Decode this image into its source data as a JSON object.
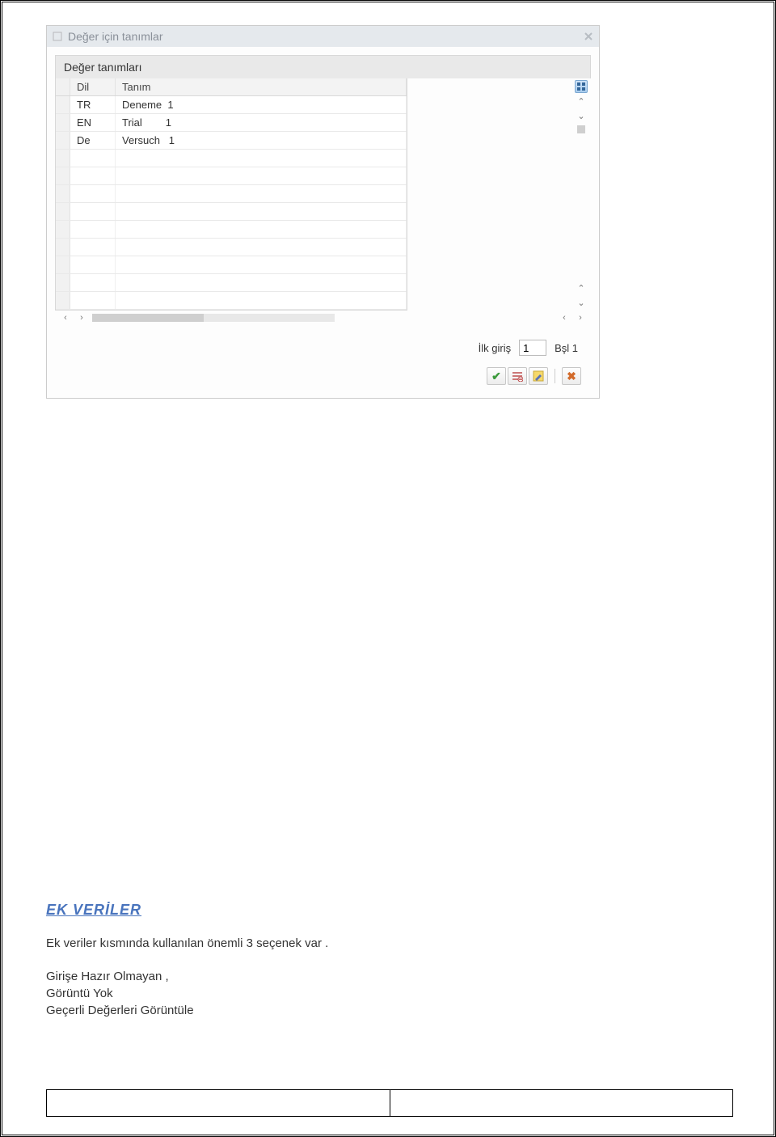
{
  "dialog": {
    "title": "Değer  için tanımlar",
    "panel_label": "Değer tanımları",
    "columns": {
      "dil": "Dil",
      "tanim": "Tanım"
    },
    "rows": [
      {
        "dil": "TR",
        "tanim": "Deneme  1"
      },
      {
        "dil": "EN",
        "tanim": "Trial        1"
      },
      {
        "dil": "De",
        "tanim": "Versuch   1"
      }
    ],
    "entry": {
      "label_ilk": "İlk giriş",
      "value": "1",
      "label_bsl": "Bşl 1"
    }
  },
  "doc": {
    "heading": "EK  VERİLER",
    "para": "Ek veriler kısmında  kullanılan önemli  3  seçenek var  .",
    "line1": "Girişe Hazır Olmayan ,",
    "line2": "Görüntü  Yok",
    "line3": "Geçerli  Değerleri Görüntüle"
  }
}
